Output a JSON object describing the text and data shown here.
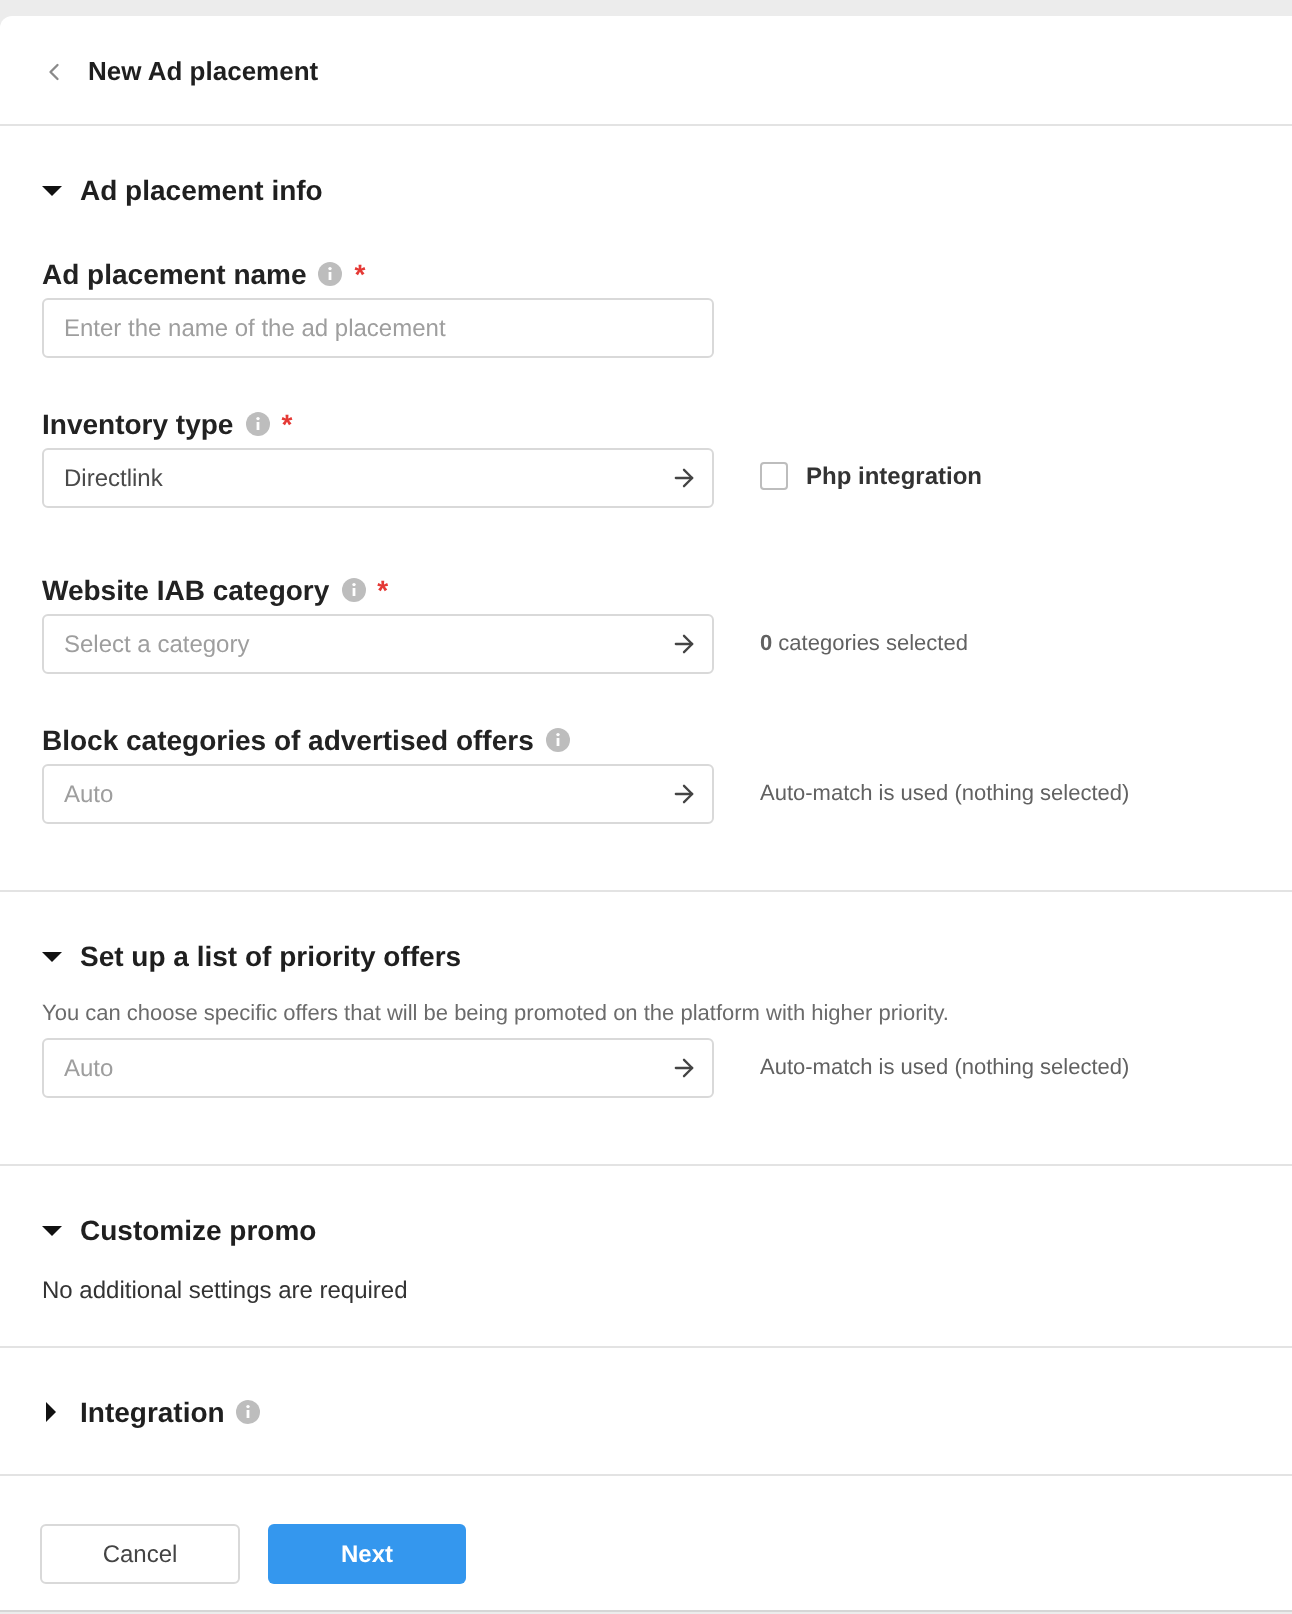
{
  "header": {
    "title": "New Ad placement"
  },
  "sections": [
    {
      "title": "Ad placement info",
      "expanded": true,
      "info": false,
      "fields": [
        {
          "label": "Ad placement name",
          "info": true,
          "required_mark": "*",
          "kind": "text",
          "placeholder": "Enter the name of the ad placement"
        },
        {
          "label": "Inventory type",
          "info": true,
          "required_mark": "*",
          "kind": "select",
          "value": "Directlink",
          "side": {
            "kind": "checkbox",
            "label": "Php integration",
            "checked": false
          }
        },
        {
          "label": "Website IAB category",
          "info": true,
          "required_mark": "*",
          "kind": "select",
          "placeholder": "Select a category",
          "side": {
            "kind": "note",
            "text": "**0** categories selected"
          }
        },
        {
          "label": "Block categories of advertised offers",
          "info": true,
          "kind": "select",
          "placeholder": "Auto",
          "side": {
            "kind": "note",
            "text": "Auto-match is used (nothing selected)"
          }
        }
      ]
    },
    {
      "title": "Set up a list of priority offers",
      "expanded": true,
      "info": false,
      "description": "You can choose specific offers that will be being promoted on the platform with higher priority.",
      "fields": [
        {
          "kind": "select",
          "placeholder": "Auto",
          "side": {
            "kind": "note",
            "text": "Auto-match is used (nothing selected)"
          }
        }
      ]
    },
    {
      "title": "Customize promo",
      "expanded": true,
      "info": false,
      "note": "No additional settings are required"
    },
    {
      "title": "Integration",
      "expanded": false,
      "info": true
    }
  ],
  "buttons": [
    {
      "label": "Cancel",
      "kind": "secondary"
    },
    {
      "label": "Next",
      "kind": "primary"
    }
  ]
}
